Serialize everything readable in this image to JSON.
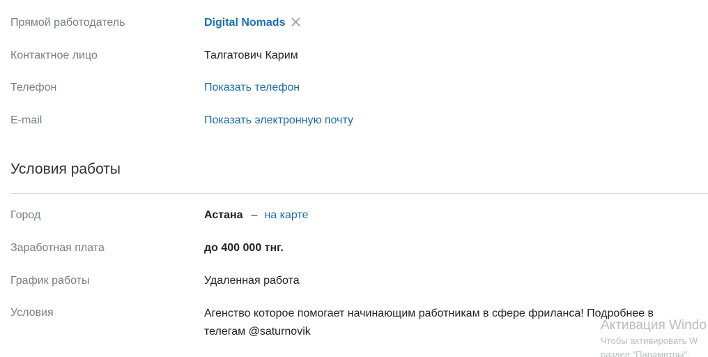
{
  "contacts": {
    "employer": {
      "label": "Прямой работодатель",
      "company_name": "Digital Nomads"
    },
    "contact_person": {
      "label": "Контактное лицо",
      "value": "Талгатович Карим"
    },
    "phone": {
      "label": "Телефон",
      "link_text": "Показать телефон"
    },
    "email": {
      "label": "E-mail",
      "link_text": "Показать электронную почту"
    }
  },
  "work_conditions": {
    "title": "Условия работы",
    "city": {
      "label": "Город",
      "value": "Астана",
      "separator": "–",
      "map_link": "на карте"
    },
    "salary": {
      "label": "Заработная плата",
      "value": "до 400 000 тнг."
    },
    "schedule": {
      "label": "График работы",
      "value": "Удаленная работа"
    },
    "conditions": {
      "label": "Условия",
      "value": "Агенство которое помогает начинающим работникам в сфере фриланса! Подробнее в телегам @saturnovik"
    }
  },
  "windows_activation": {
    "title": "Активация Windo",
    "line1": "Чтобы активировать W",
    "line2": "раздел \"Параметры\"."
  },
  "colors": {
    "link": "#1a6fb0",
    "label": "#7a7f84",
    "text": "#222222",
    "divider": "#dcdcdc"
  }
}
